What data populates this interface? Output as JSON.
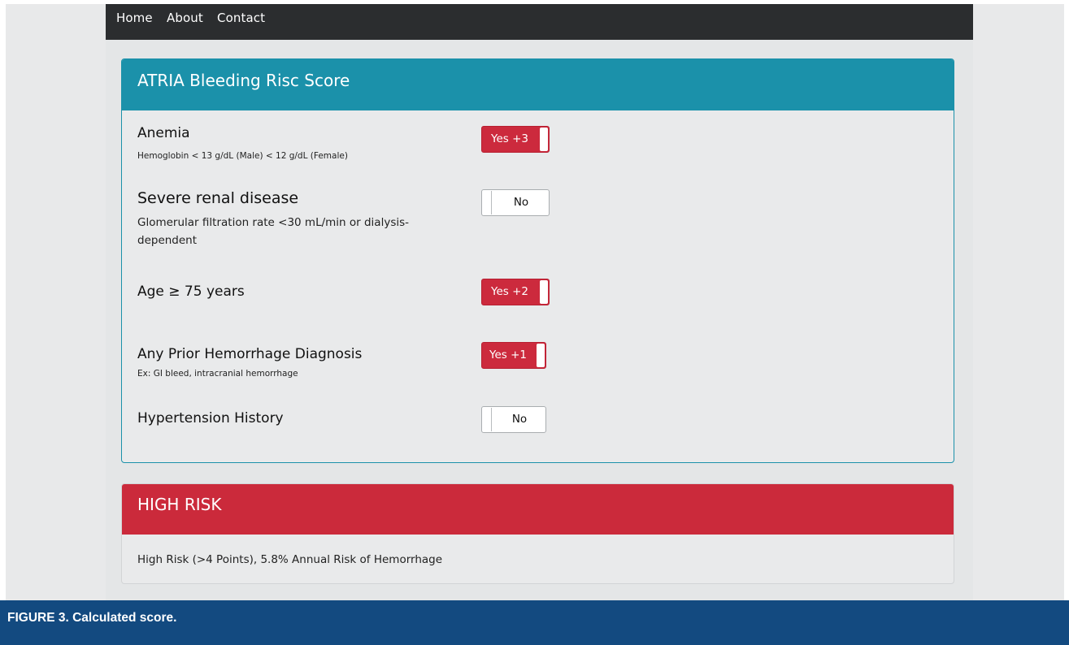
{
  "nav": {
    "items": [
      "Home",
      "About",
      "Contact"
    ]
  },
  "calculator": {
    "title": "ATRIA Bleeding Risc Score",
    "criteria": [
      {
        "title": "Anemia",
        "subtitle": "Hemoglobin < 13 g/dL (Male) < 12 g/dL (Female)",
        "toggle": "Yes +3",
        "selected": true
      },
      {
        "title": "Severe renal disease",
        "subtitle": "Glomerular filtration rate <30 mL/min or dialysis-dependent",
        "toggle": "No",
        "selected": false
      },
      {
        "title": "Age ≥ 75 years",
        "subtitle": "",
        "toggle": "Yes +2",
        "selected": true
      },
      {
        "title": "Any Prior Hemorrhage Diagnosis",
        "subtitle": "Ex: GI bleed, intracranial hemorrhage",
        "toggle": "Yes +1",
        "selected": true
      },
      {
        "title": "Hypertension History",
        "subtitle": "",
        "toggle": "No",
        "selected": false
      }
    ]
  },
  "result": {
    "title": "HIGH RISK",
    "description": "High Risk (>4 Points), 5.8% Annual Risk of Hemorrhage"
  },
  "figure": {
    "caption": "FIGURE 3. Calculated score."
  },
  "colors": {
    "header_teal": "#1b91aa",
    "toggle_on_red": "#cc2a3d",
    "risk_red": "#cb2a3b",
    "navbar_dark": "#2b2d2f",
    "caption_blue": "#134a80"
  }
}
